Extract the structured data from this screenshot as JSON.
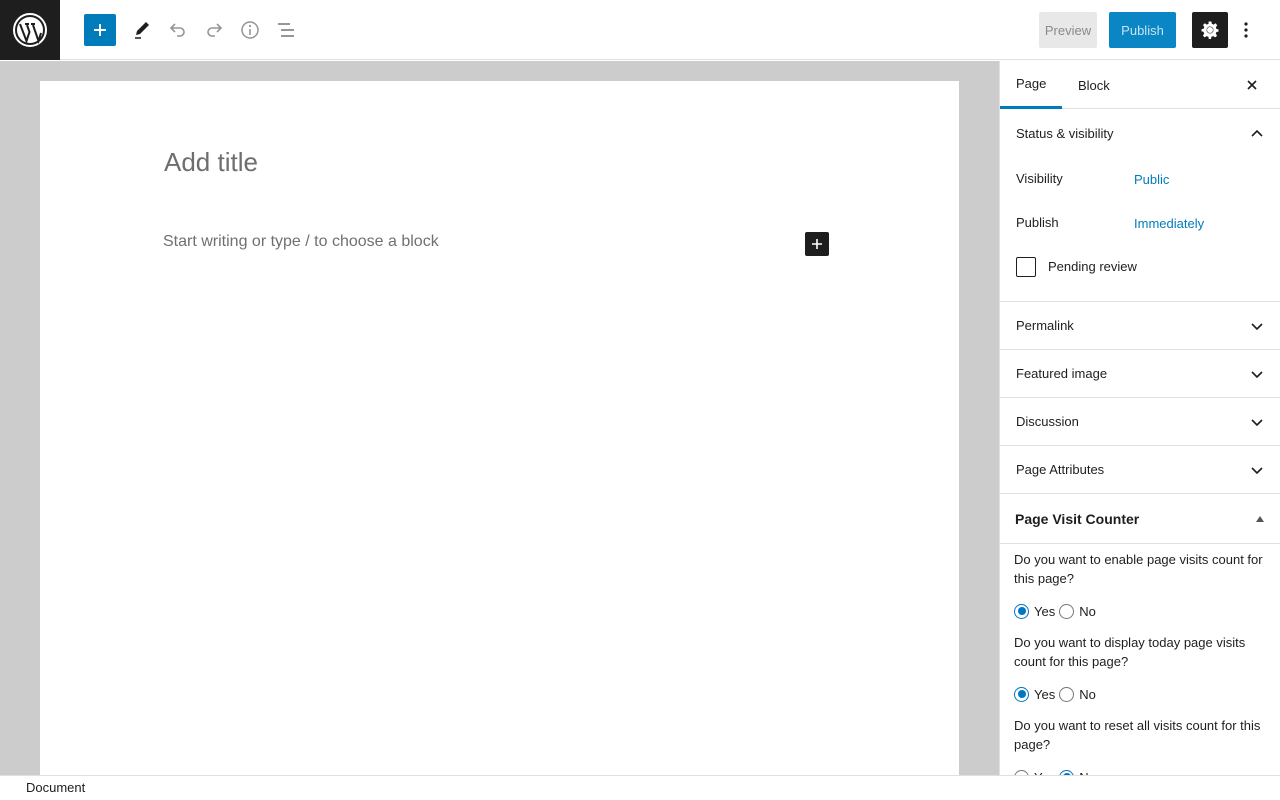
{
  "header": {
    "preview_label": "Preview",
    "publish_label": "Publish",
    "icons": [
      "wordpress-logo",
      "plus-icon",
      "pencil-icon",
      "undo-icon",
      "redo-icon",
      "info-icon",
      "list-view-icon",
      "gear-icon",
      "kebab-icon"
    ]
  },
  "editor": {
    "title_placeholder": "Add title",
    "block_placeholder": "Start writing or type / to choose a block"
  },
  "sidebar": {
    "tabs": [
      {
        "label": "Page",
        "active": true
      },
      {
        "label": "Block",
        "active": false
      }
    ],
    "status_visibility": {
      "title": "Status & visibility",
      "visibility_label": "Visibility",
      "visibility_value": "Public",
      "publish_label": "Publish",
      "publish_value": "Immediately",
      "pending_review_label": "Pending review"
    },
    "panels": [
      {
        "title": "Permalink"
      },
      {
        "title": "Featured image"
      },
      {
        "title": "Discussion"
      },
      {
        "title": "Page Attributes"
      }
    ],
    "page_visit_counter": {
      "title": "Page Visit Counter",
      "questions": [
        {
          "text": "Do you want to enable page visits count for this page?",
          "selected": "Yes"
        },
        {
          "text": "Do you want to display today page visits count for this page?",
          "selected": "Yes"
        },
        {
          "text": "Do you want to reset all visits count for this page?",
          "selected": "No"
        }
      ],
      "yes_label": "Yes",
      "no_label": "No"
    }
  },
  "footer": {
    "breadcrumb": "Document"
  },
  "colors": {
    "accent": "#007cba",
    "dark": "#1e1e1e",
    "canvas_bg": "#cccccc"
  }
}
